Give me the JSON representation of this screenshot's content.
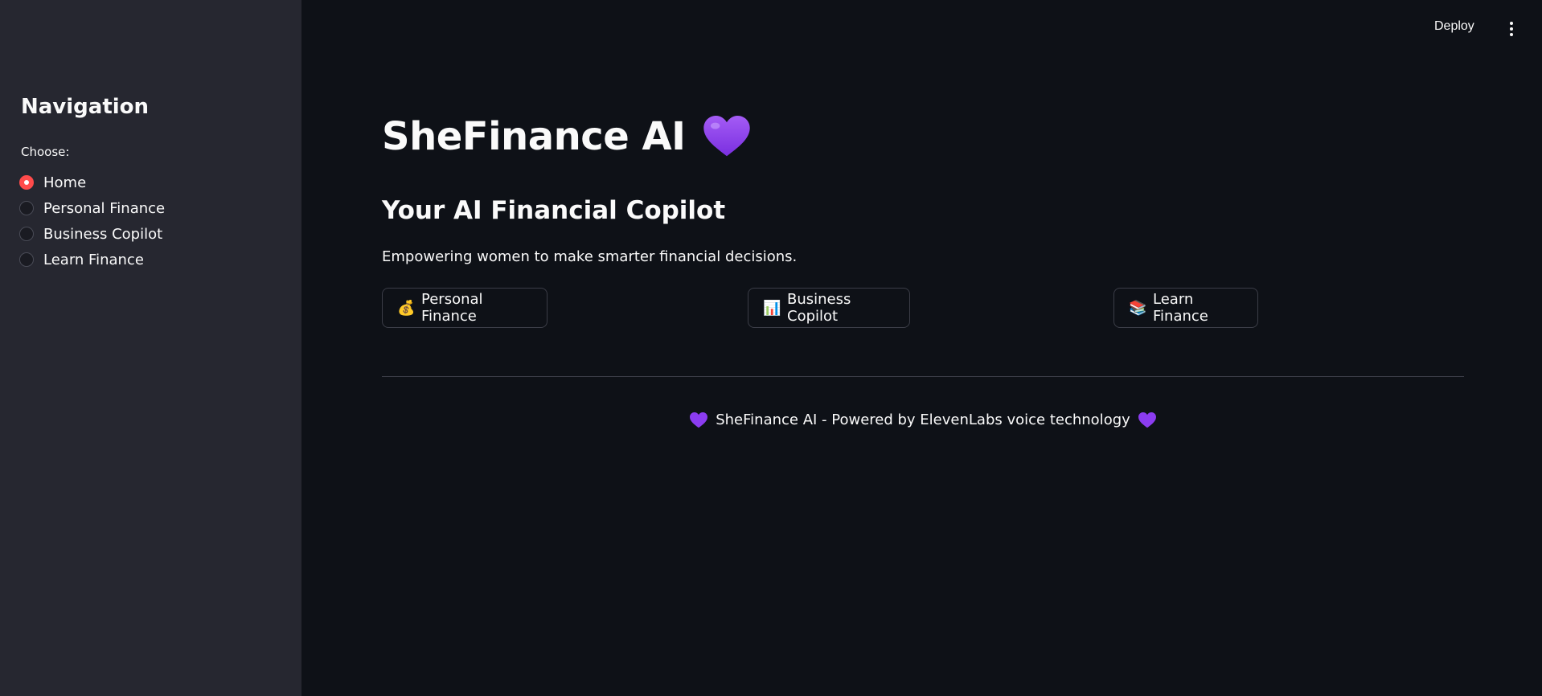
{
  "sidebar": {
    "title": "Navigation",
    "radio_label": "Choose:",
    "options": [
      {
        "label": "Home",
        "selected": true
      },
      {
        "label": "Personal Finance",
        "selected": false
      },
      {
        "label": "Business Copilot",
        "selected": false
      },
      {
        "label": "Learn Finance",
        "selected": false
      }
    ]
  },
  "header": {
    "deploy_label": "Deploy",
    "menu_icon": "vertical-dots-icon"
  },
  "main": {
    "title": "SheFinance AI",
    "title_icon": "purple-heart-icon",
    "subtitle": "Your AI Financial Copilot",
    "tagline": "Empowering women to make smarter financial decisions.",
    "buttons": [
      {
        "icon": "💰",
        "label": "Personal Finance"
      },
      {
        "icon": "📊",
        "label": "Business Copilot"
      },
      {
        "icon": "📚",
        "label": "Learn Finance"
      }
    ],
    "footer_text": "SheFinance AI - Powered by ElevenLabs voice technology"
  },
  "colors": {
    "background": "#0e1117",
    "sidebar": "#262730",
    "accent": "#ff4b4b",
    "heart": "#8b3cf0"
  }
}
